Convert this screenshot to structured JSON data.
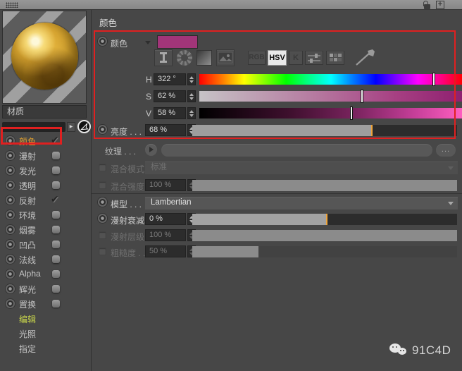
{
  "titlebar": {
    "icons": [
      "grip-icon",
      "unlock-icon",
      "add-icon"
    ]
  },
  "preview": {
    "name_field": "材质"
  },
  "sidebar": {
    "channels": [
      {
        "label": "颜色",
        "checked": true
      },
      {
        "label": "漫射",
        "checked": false
      },
      {
        "label": "发光",
        "checked": false
      },
      {
        "label": "透明",
        "checked": false
      },
      {
        "label": "反射",
        "checked": true
      },
      {
        "label": "环境",
        "checked": false
      },
      {
        "label": "烟雾",
        "checked": false
      },
      {
        "label": "凹凸",
        "checked": false
      },
      {
        "label": "法线",
        "checked": false
      },
      {
        "label": "Alpha",
        "checked": false
      },
      {
        "label": "辉光",
        "checked": false
      },
      {
        "label": "置换",
        "checked": false
      }
    ],
    "modes": [
      {
        "label": "编辑",
        "active": true
      },
      {
        "label": "光照",
        "active": false
      },
      {
        "label": "指定",
        "active": false
      }
    ]
  },
  "main": {
    "section_title": "颜色",
    "color_row": {
      "label": "颜色",
      "swatch_color": "#a23579"
    },
    "toolbar": {
      "rgb_label": "RGB",
      "hsv_label": "HSV",
      "k_label": "K"
    },
    "hsv": {
      "h": {
        "label": "H",
        "value": "322 °",
        "percent": 89.4
      },
      "s": {
        "label": "S",
        "value": "62 %",
        "percent": 62
      },
      "v": {
        "label": "V",
        "value": "58 %",
        "percent": 58
      }
    },
    "brightness": {
      "label": "亮度 . . .",
      "value": "68 %",
      "percent": 68
    },
    "texture": {
      "label": "纹理 . . .",
      "value": "",
      "more_label": "..."
    },
    "mix_mode": {
      "label": "混合模式",
      "value": "标准"
    },
    "mix_strength": {
      "label": "混合强度",
      "value": "100 %",
      "percent": 100
    },
    "model": {
      "label": "模型 . . .",
      "value": "Lambertian"
    },
    "diffuse_falloff": {
      "label": "漫射衰减",
      "value": "0 %",
      "percent": 51
    },
    "diffuse_level": {
      "label": "漫射层级",
      "value": "100 %",
      "percent": 100
    },
    "roughness": {
      "label": "粗糙度 . .",
      "value": "50 %",
      "percent": 25
    }
  },
  "watermark": {
    "text": "91C4D"
  },
  "colors": {
    "annotation_red": "#e02020",
    "accent_orange": "#eda43c",
    "swatch_magenta": "#a23579",
    "channel_active_orange": "#e0a030",
    "mode_active_yellow": "#c9d64b",
    "hsv_button_active_bg": "#e9e9e9"
  }
}
